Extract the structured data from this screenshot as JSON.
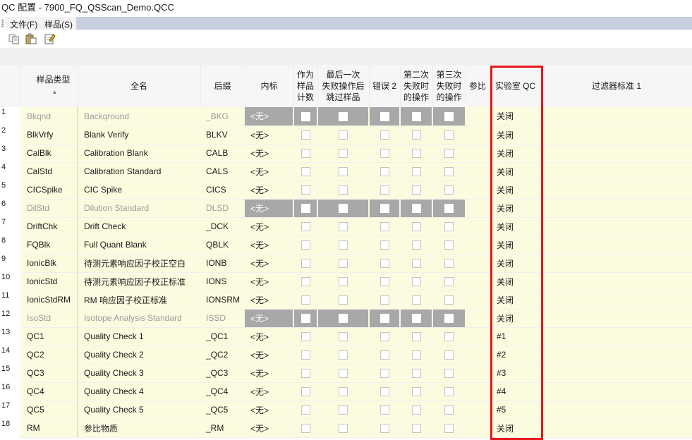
{
  "window": {
    "title": "QC 配置 - 7900_FQ_QSScan_Demo.QCC"
  },
  "menu": {
    "file": "文件(F)",
    "sample": "样品(S)"
  },
  "toolbar": {
    "copy_icon": "copy-icon",
    "paste_icon": "paste-icon",
    "edit_icon": "edit-icon"
  },
  "headers": {
    "type": "样品类型",
    "full_name": "全名",
    "suffix": "后缀",
    "istd": "内标",
    "as_sample_1": "作为",
    "as_sample_2": "样品",
    "as_sample_3": "计数",
    "last_fail_1": "最后一次",
    "last_fail_2": "失败操作后",
    "last_fail_3": "跳过样品",
    "error2": "错误 2",
    "second_fail_1": "第二次",
    "second_fail_2": "失败时",
    "second_fail_3": "的操作",
    "third_fail_1": "第三次",
    "third_fail_2": "失败时",
    "third_fail_3": "的操作",
    "ref": "参比",
    "lab_qc": "实验室 QC",
    "filter": "过滤器标准 1"
  },
  "rows": [
    {
      "num": "1",
      "type": "Bkqnd",
      "name": "Backqround",
      "suffix": "_BKG",
      "istd": "<无>",
      "lab_qc": "关闭"
    },
    {
      "num": "2",
      "type": "BlkVrfy",
      "name": "Blank Verify",
      "suffix": "BLKV",
      "istd": "<无>",
      "lab_qc": "关闭"
    },
    {
      "num": "3",
      "type": "CalBlk",
      "name": "Calibration Blank",
      "suffix": "CALB",
      "istd": "<无>",
      "lab_qc": "关闭"
    },
    {
      "num": "4",
      "type": "CalStd",
      "name": "Calibration Standard",
      "suffix": "CALS",
      "istd": "<无>",
      "lab_qc": "关闭"
    },
    {
      "num": "5",
      "type": "CICSpike",
      "name": "CIC Spike",
      "suffix": "CICS",
      "istd": "<无>",
      "lab_qc": "关闭"
    },
    {
      "num": "6",
      "type": "DilStd",
      "name": "Dilution Standard",
      "suffix": "DLSD",
      "istd": "<无>",
      "lab_qc": "关闭"
    },
    {
      "num": "7",
      "type": "DriftChk",
      "name": "Drift Check",
      "suffix": "_DCK",
      "istd": "<无>",
      "lab_qc": "关闭"
    },
    {
      "num": "8",
      "type": "FQBlk",
      "name": "Full Quant Blank",
      "suffix": "QBLK",
      "istd": "<无>",
      "lab_qc": "关闭"
    },
    {
      "num": "9",
      "type": "IonicBlk",
      "name": "待测元素响应因子校正空白",
      "suffix": "IONB",
      "istd": "<无>",
      "lab_qc": "关闭"
    },
    {
      "num": "10",
      "type": "IonicStd",
      "name": "待测元素响应因子校正标准",
      "suffix": "IONS",
      "istd": "<无>",
      "lab_qc": "关闭"
    },
    {
      "num": "11",
      "type": "IonicStdRM",
      "name": "RM 响应因子校正标准",
      "suffix": "IONSRM",
      "istd": "<无>",
      "lab_qc": "关闭"
    },
    {
      "num": "12",
      "type": "IsoStd",
      "name": "Isotope Analysis Standard",
      "suffix": "ISSD",
      "istd": "<无>",
      "lab_qc": "关闭"
    },
    {
      "num": "13",
      "type": "QC1",
      "name": "Quality Check 1",
      "suffix": "_QC1",
      "istd": "<无>",
      "lab_qc": "#1"
    },
    {
      "num": "14",
      "type": "QC2",
      "name": "Quality Check 2",
      "suffix": "_QC2",
      "istd": "<无>",
      "lab_qc": "#2"
    },
    {
      "num": "15",
      "type": "QC3",
      "name": "Quality Check 3",
      "suffix": "_QC3",
      "istd": "<无>",
      "lab_qc": "#3"
    },
    {
      "num": "16",
      "type": "QC4",
      "name": "Quality Check 4",
      "suffix": "_QC4",
      "istd": "<无>",
      "lab_qc": "#4"
    },
    {
      "num": "17",
      "type": "QC5",
      "name": "Quality Check 5",
      "suffix": "_QC5",
      "istd": "<无>",
      "lab_qc": "#5"
    },
    {
      "num": "18",
      "type": "RM",
      "name": "参比物质",
      "suffix": "_RM",
      "istd": "<无>",
      "lab_qc": "关闭"
    }
  ],
  "colors": {
    "row_bg": "#fbfbe0",
    "disabled_bg": "#a8a8a8",
    "highlight": "#e8161b",
    "menubar_bg": "#c8d0e0"
  }
}
